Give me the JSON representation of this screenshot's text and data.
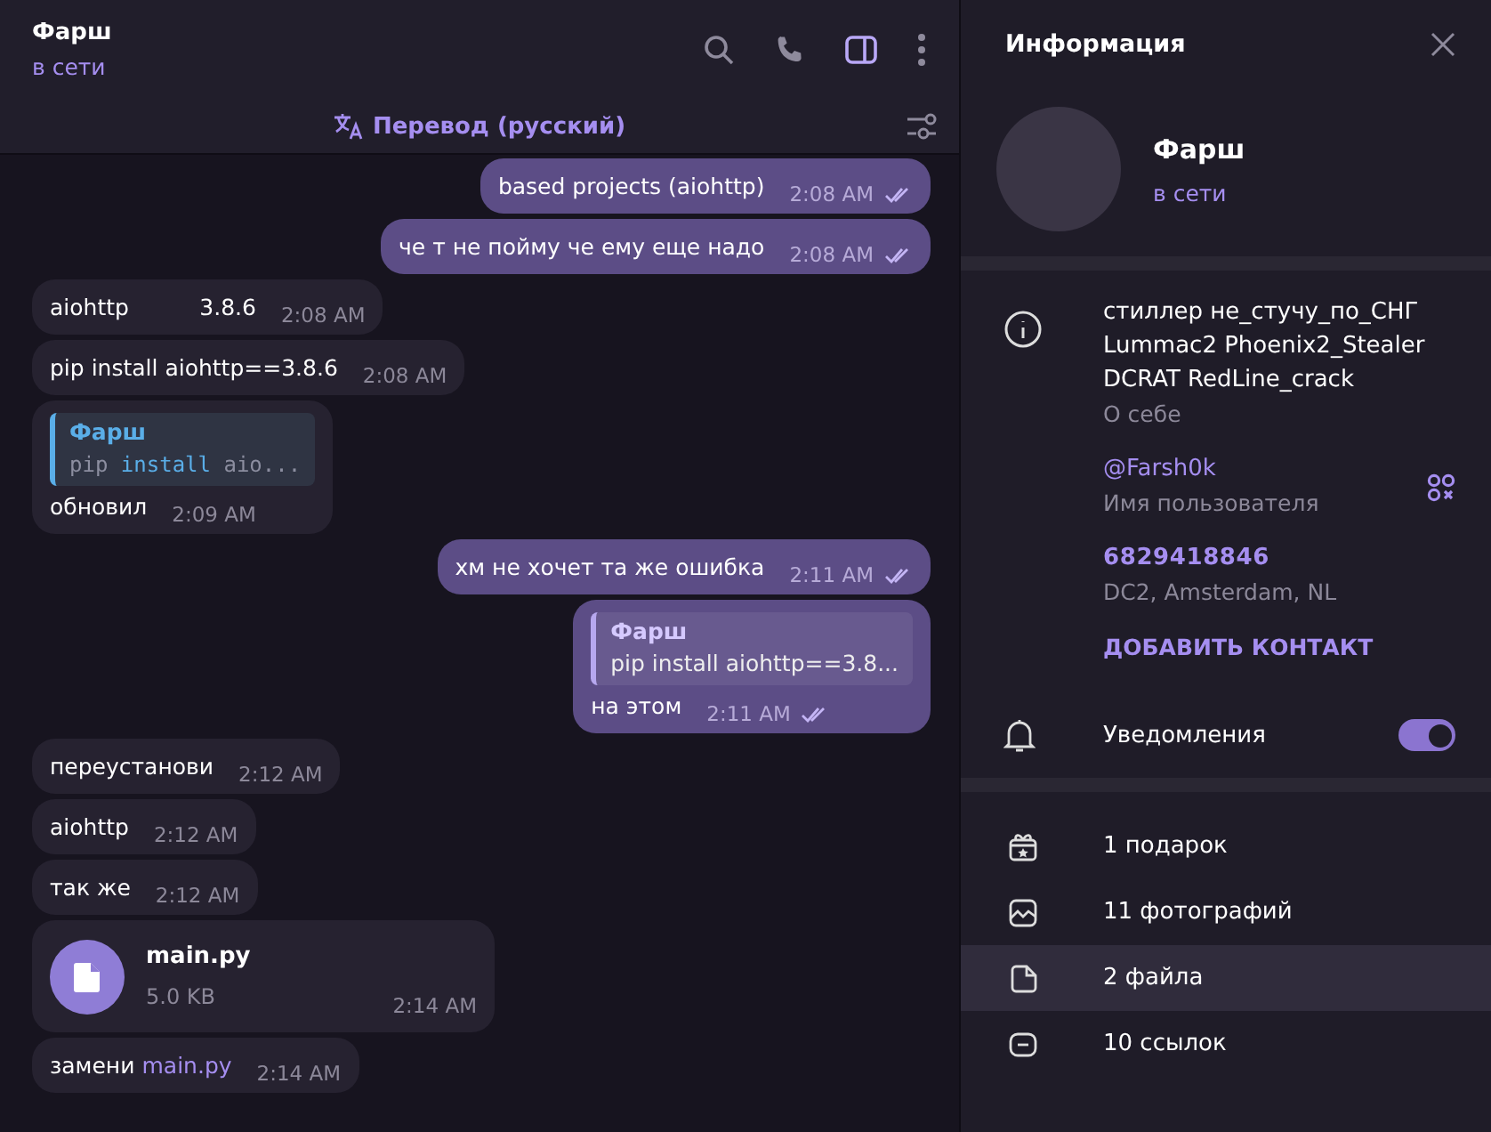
{
  "chat": {
    "title": "Фарш",
    "status": "в сети",
    "info_panel_open": true,
    "translate_label": "Перевод (русский)"
  },
  "messages": [
    {
      "kind": "text",
      "outgoing": true,
      "text": "based projects (aiohttp)",
      "time": "2:08 AM",
      "read": true
    },
    {
      "kind": "text",
      "outgoing": true,
      "text": "че т не пойму че ему еще надо",
      "time": "2:08 AM",
      "read": true
    },
    {
      "kind": "text",
      "outgoing": false,
      "text": "aiohttp          3.8.6",
      "time": "2:08 AM"
    },
    {
      "kind": "text",
      "outgoing": false,
      "text": "pip install aiohttp==3.8.6",
      "time": "2:08 AM"
    },
    {
      "kind": "reply",
      "outgoing": false,
      "quote_author": "Фарш",
      "quote_code": true,
      "quote_parts": [
        "pip",
        "install",
        "aio..."
      ],
      "text": "обновил",
      "time": "2:09 AM"
    },
    {
      "kind": "text",
      "outgoing": true,
      "text": "хм не хочет та же ошибка",
      "time": "2:11 AM",
      "read": true
    },
    {
      "kind": "reply",
      "outgoing": true,
      "quote_author": "Фарш",
      "quote_code": false,
      "quote_parts": [
        "pip install aiohttp==3.8..."
      ],
      "text": "на этом",
      "time": "2:11 AM",
      "read": true
    },
    {
      "kind": "text",
      "outgoing": false,
      "text": "переустанови",
      "time": "2:12 AM"
    },
    {
      "kind": "text",
      "outgoing": false,
      "text": "aiohttp",
      "time": "2:12 AM"
    },
    {
      "kind": "text",
      "outgoing": false,
      "text": "так же",
      "time": "2:12 AM"
    },
    {
      "kind": "file",
      "outgoing": false,
      "file_name": "main.py",
      "file_size": "5.0 KB",
      "time": "2:14 AM"
    },
    {
      "kind": "link",
      "outgoing": false,
      "text": "замени",
      "link": "main.py",
      "time": "2:14 AM"
    }
  ],
  "info": {
    "title": "Информация",
    "name": "Фарш",
    "status": "в сети",
    "bio": "стиллер не_стучу_по_СНГ\nLummac2 Phoenix2_Stealer\nDCRAT RedLine_crack",
    "bio_label": "О себе",
    "username": "@Farsh0k",
    "username_label": "Имя пользователя",
    "user_id": "6829418846",
    "datacenter": "DC2, Amsterdam, NL",
    "add_contact": "ДОБАВИТЬ КОНТАКТ",
    "notifications_label": "Уведомления",
    "notifications_on": true
  },
  "media": [
    {
      "kind": "gift",
      "label": "1 подарок",
      "selected": false
    },
    {
      "kind": "photo",
      "label": "11 фотографий",
      "selected": false
    },
    {
      "kind": "file",
      "label": "2 файла",
      "selected": true
    },
    {
      "kind": "link",
      "label": "10 ссылок",
      "selected": false
    }
  ]
}
